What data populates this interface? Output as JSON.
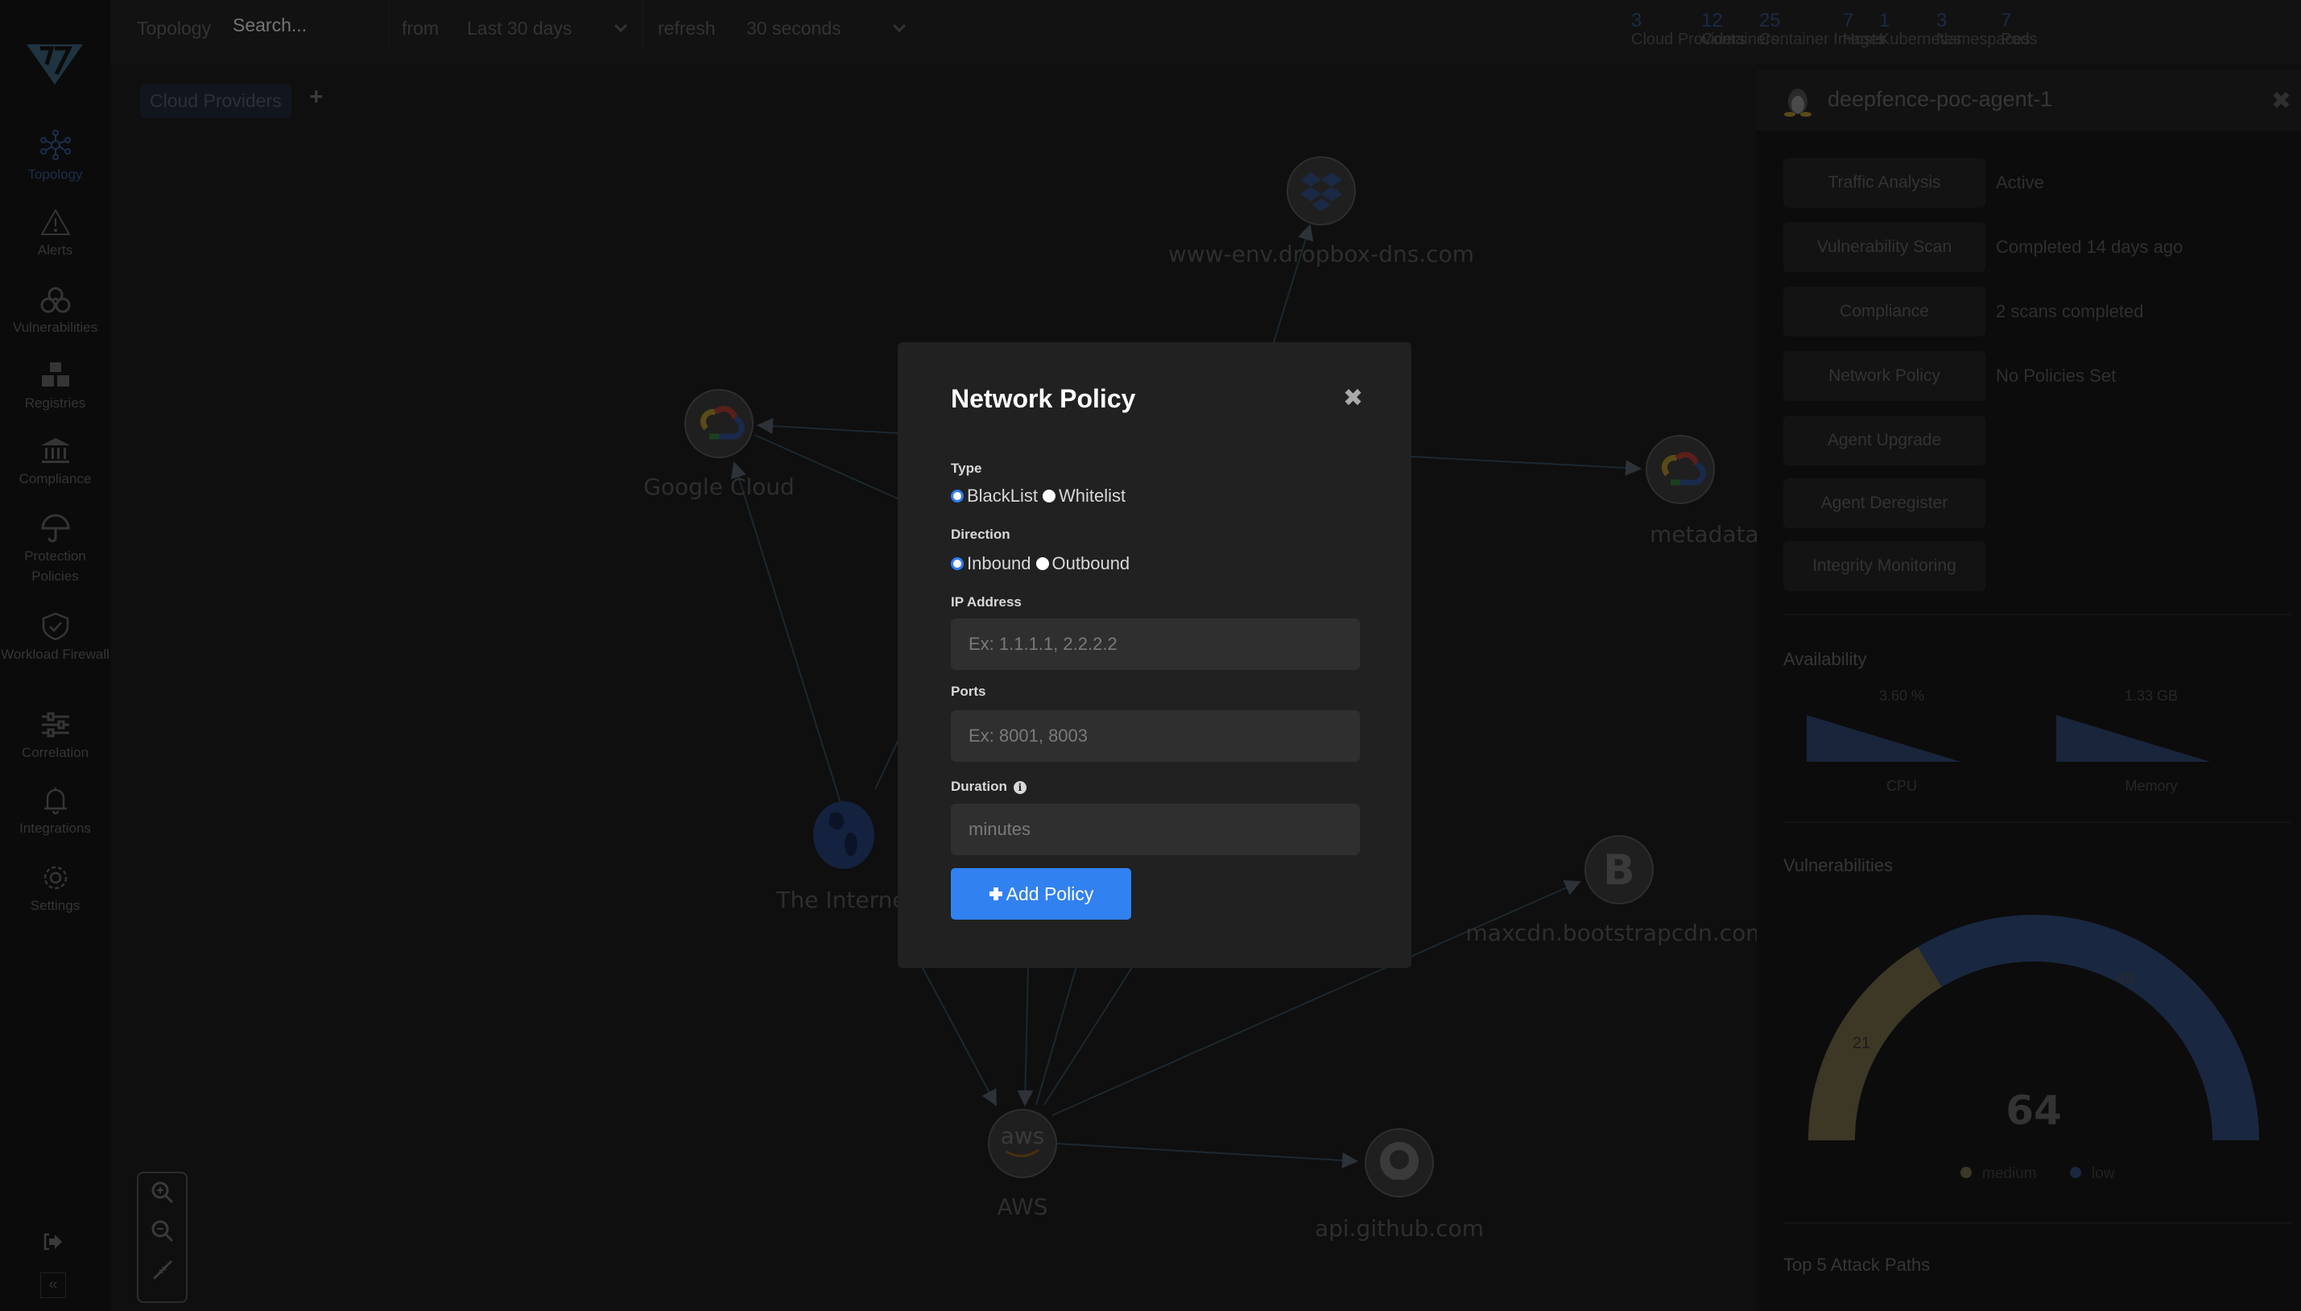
{
  "topbar": {
    "view_label": "Topology",
    "search_placeholder": "Search...",
    "from_label": "from",
    "from_value": "Last 30 days",
    "refresh_label": "refresh",
    "refresh_value": "30 seconds",
    "stats": [
      {
        "count": "3",
        "label": "Cloud Providers"
      },
      {
        "count": "12",
        "label": "Containers"
      },
      {
        "count": "25",
        "label": "Container Images"
      },
      {
        "count": "7",
        "label": "Hosts"
      },
      {
        "count": "1",
        "label": "Kubernetes"
      },
      {
        "count": "3",
        "label": "Namespaces"
      },
      {
        "count": "7",
        "label": "Pods"
      }
    ]
  },
  "sidebar": {
    "items": [
      {
        "label": "Topology",
        "icon": "topology-icon",
        "active": true
      },
      {
        "label": "Alerts",
        "icon": "alert-triangle-icon"
      },
      {
        "label": "Vulnerabilities",
        "icon": "biohazard-icon"
      },
      {
        "label": "Registries",
        "icon": "boxes-icon"
      },
      {
        "label": "Compliance",
        "icon": "bank-icon"
      },
      {
        "label": "Protection Policies",
        "icon": "umbrella-icon"
      },
      {
        "label": "Workload Firewall",
        "icon": "shield-check-icon"
      },
      {
        "label": "Correlation",
        "icon": "sliders-icon"
      },
      {
        "label": "Integrations",
        "icon": "bell-icon"
      },
      {
        "label": "Settings",
        "icon": "gear-icon"
      }
    ],
    "collapse_glyph": "«"
  },
  "canvas": {
    "filter_chip": "Cloud Providers",
    "add_glyph": "+",
    "nodes": [
      {
        "label": "www-env.dropbox-dns.com",
        "icon": "dropbox-icon"
      },
      {
        "label": "Google Cloud",
        "icon": "google-cloud-icon"
      },
      {
        "label": "metadata.google.int",
        "icon": "google-cloud-icon"
      },
      {
        "label": "The Interne",
        "icon": "globe-icon"
      },
      {
        "label": "maxcdn.bootstrapcdn.com",
        "icon": "bootstrap-icon"
      },
      {
        "label": "AWS",
        "icon": "aws-icon"
      },
      {
        "label": "api.github.com",
        "icon": "github-icon"
      }
    ]
  },
  "panel": {
    "title": "deepfence-poc-agent-1",
    "close_glyph": "✖",
    "actions": [
      {
        "label": "Traffic Analysis",
        "value": "Active"
      },
      {
        "label": "Vulnerability Scan",
        "value": "Completed 14 days ago"
      },
      {
        "label": "Compliance",
        "value": "2 scans completed"
      },
      {
        "label": "Network Policy",
        "value": "No Policies Set"
      },
      {
        "label": "Agent Upgrade",
        "value": ""
      },
      {
        "label": "Agent Deregister",
        "value": ""
      },
      {
        "label": "Integrity Monitoring",
        "value": ""
      }
    ],
    "availability": {
      "title": "Availability",
      "cpu": {
        "value": "3.60 %",
        "label": "CPU"
      },
      "memory": {
        "value": "1.33 GB",
        "label": "Memory"
      }
    },
    "vulnerabilities": {
      "title": "Vulnerabilities",
      "total": "64",
      "segments": [
        {
          "name": "medium",
          "value": 21,
          "color": "#3d3725"
        },
        {
          "name": "low",
          "value": 43,
          "color": "#1a2740"
        }
      ]
    },
    "attack_paths_title": "Top 5 Attack Paths"
  },
  "modal": {
    "title": "Network Policy",
    "close_glyph": "✖",
    "type_label": "Type",
    "type_options": [
      "BlackList",
      "Whitelist"
    ],
    "type_selected": "BlackList",
    "direction_label": "Direction",
    "direction_options": [
      "Inbound",
      "Outbound"
    ],
    "direction_selected": "Inbound",
    "ip_label": "IP Address",
    "ip_placeholder": "Ex: 1.1.1.1, 2.2.2.2",
    "ports_label": "Ports",
    "ports_placeholder": "Ex: 8001, 8003",
    "duration_label": "Duration",
    "duration_placeholder": "minutes",
    "submit_label": "Add Policy",
    "accent": "#3181f1"
  }
}
